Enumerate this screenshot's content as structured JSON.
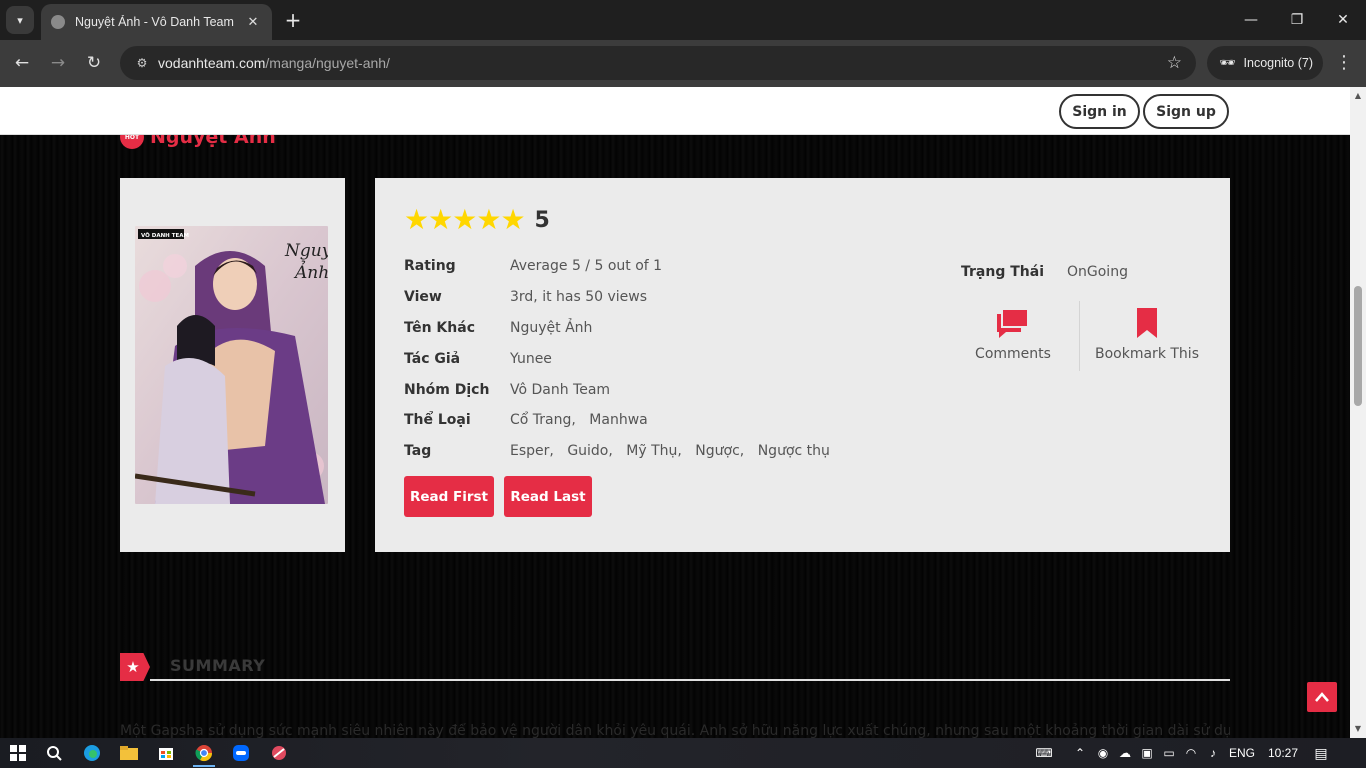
{
  "browser": {
    "tab_title": "Nguyệt Ảnh - Vô Danh Team",
    "url_host": "vodanhteam.com",
    "url_path": "/manga/nguyet-anh/",
    "incognito_label": "Incognito (7)"
  },
  "header": {
    "sign_in": "Sign in",
    "sign_up": "Sign up"
  },
  "manga": {
    "hot_badge": "HOT",
    "title": "Nguyệt Ảnh",
    "cover_publisher": "VÔ DANH TEAM",
    "cover_title": "Nguyệt Ảnh",
    "rating_score": "5",
    "rating_stars": 5,
    "details": [
      {
        "label": "Rating",
        "value": "Average 5 / 5 out of 1"
      },
      {
        "label": "View",
        "value": "3rd, it has 50 views"
      },
      {
        "label": "Tên Khác",
        "value": "Nguyệt Ảnh"
      },
      {
        "label": "Tác Giả",
        "value": "Yunee"
      },
      {
        "label": "Nhóm Dịch",
        "value": "Vô Danh Team"
      }
    ],
    "genres_label": "Thể Loại",
    "genres": [
      "Cổ Trang,",
      "Manhwa"
    ],
    "tags_label": "Tag",
    "tags": [
      "Esper,",
      "Guido,",
      "Mỹ Thụ,",
      "Ngược,",
      "Ngược thụ"
    ],
    "read_first": "Read First",
    "read_last": "Read Last",
    "status_label": "Trạng Thái",
    "status_value": "OnGoing",
    "comments_label": "Comments",
    "bookmark_label": "Bookmark This"
  },
  "summary": {
    "title": "SUMMARY",
    "text": "Một Gapsha sử dụng sức mạnh siêu nhiên này để bảo vệ người dân khỏi yêu quái. Anh sở hữu năng lực xuất chúng, nhưng sau một khoảng thời gian dài sử dụng"
  },
  "taskbar": {
    "language": "ENG",
    "time": "10:27"
  },
  "colors": {
    "accent": "#e52d45",
    "star": "#ffd700",
    "panel": "#ebebeb"
  }
}
